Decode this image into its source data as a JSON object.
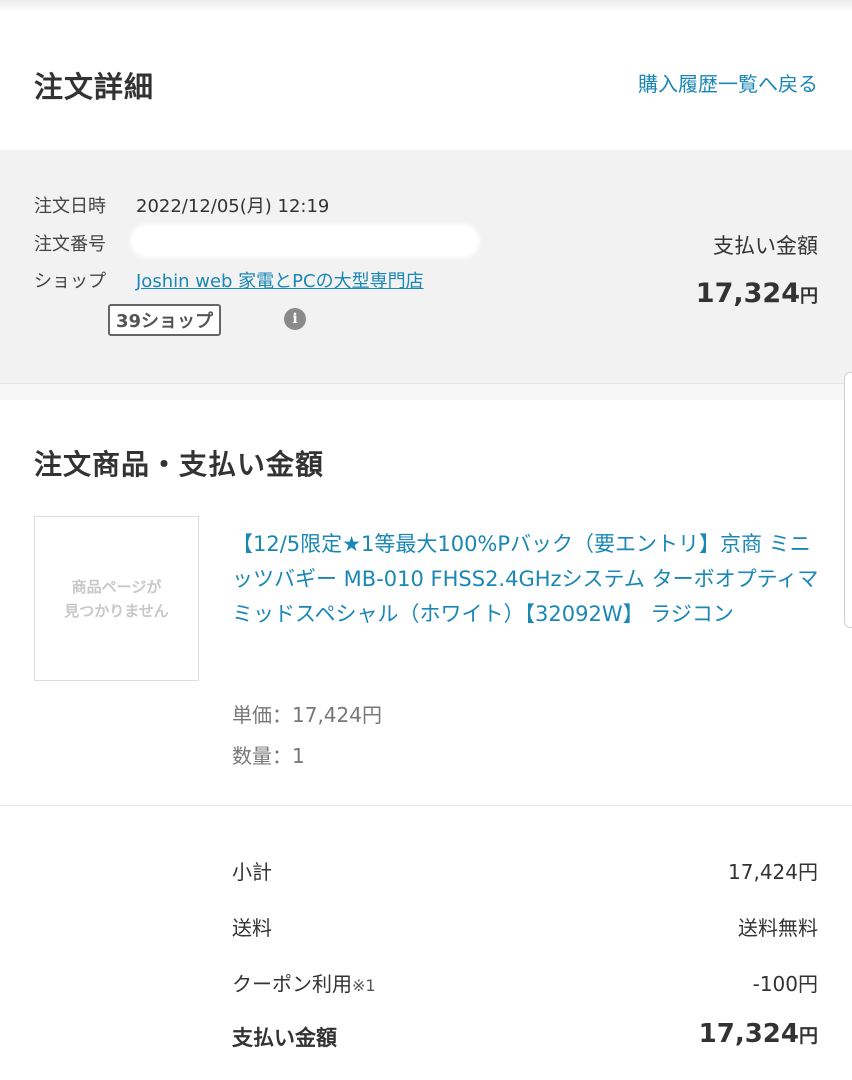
{
  "header": {
    "title": "注文詳細",
    "back_link": "購入履歴一覧へ戻る"
  },
  "order_info": {
    "date_label": "注文日時",
    "date_value": "2022/12/05(月) 12:19",
    "number_label": "注文番号",
    "shop_label": "ショップ",
    "shop_name": "Joshin web 家電とPCの大型専門店",
    "shop_badge": "39ショップ",
    "info_icon": "i",
    "payment_label": "支払い金額",
    "payment_amount": "17,324",
    "payment_unit": "円"
  },
  "items_section": {
    "title": "注文商品・支払い金額",
    "product": {
      "image_placeholder_line1": "商品ページが",
      "image_placeholder_line2": "見つかりません",
      "name": "【12/5限定★1等最大100%Pバック（要エントリ】京商 ミニッツバギー MB-010 FHSS2.4GHzシステム ターボオプティマミッドスペシャル（ホワイト）【32092W】 ラジコン",
      "unit_price": "単価：17,424円",
      "quantity": "数量：1"
    }
  },
  "summary": {
    "subtotal_label": "小計",
    "subtotal_value": "17,424円",
    "shipping_label": "送料",
    "shipping_value": "送料無料",
    "coupon_label": "クーポン利用",
    "coupon_note": "※1",
    "coupon_value": "-100円",
    "total_label": "支払い金額",
    "total_amount": "17,324",
    "total_unit": "円"
  },
  "colors": {
    "link": "#1a87b5",
    "info_background": "#f2f2f2",
    "text": "#333333",
    "muted_text": "#777777"
  }
}
